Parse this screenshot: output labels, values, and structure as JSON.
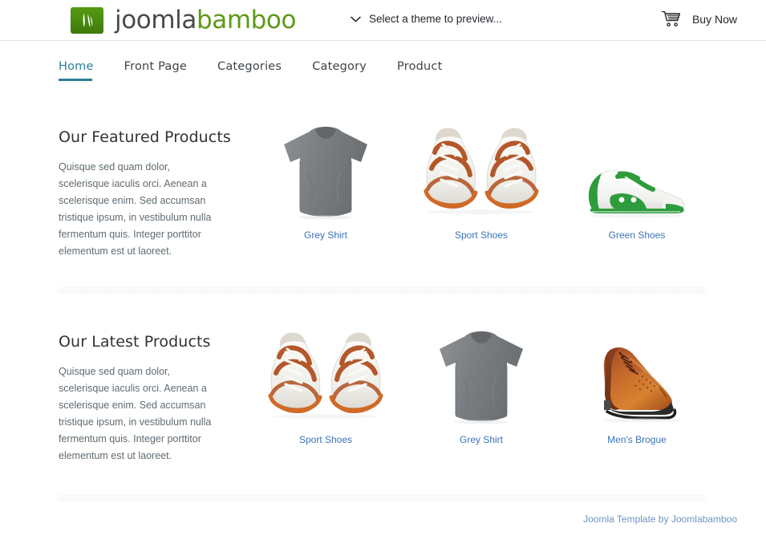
{
  "header": {
    "logo": {
      "icon": "bamboo-leaf-icon",
      "text_primary": "joomla",
      "text_secondary": "bamboo",
      "brand_green": "#5e9a18",
      "mark_bg": "#4b8a10"
    },
    "theme_selector": {
      "icon": "chevron-down-icon",
      "label": "Select a theme to preview..."
    },
    "buy": {
      "icon": "shopping-cart-icon",
      "label": "Buy Now"
    }
  },
  "nav": {
    "active_color": "#2b7d95",
    "items": [
      {
        "label": "Home",
        "active": true
      },
      {
        "label": "Front Page",
        "active": false
      },
      {
        "label": "Categories",
        "active": false
      },
      {
        "label": "Category",
        "active": false
      },
      {
        "label": "Product",
        "active": false
      }
    ]
  },
  "sections": [
    {
      "title": "Our Featured Products",
      "body": "Quisque sed quam dolor, scelerisque iaculis orci. Aenean a scelerisque enim. Sed accumsan tristique ipsum, in vestibulum nulla fermentum quis. Integer porttitor elementum est ut laoreet.",
      "products": [
        {
          "label": "Grey Shirt",
          "image": "grey-tshirt-image"
        },
        {
          "label": "Sport Shoes",
          "image": "white-orange-sneakers-front-image"
        },
        {
          "label": "Green Shoes",
          "image": "green-white-sneaker-side-image"
        }
      ]
    },
    {
      "title": "Our Latest Products",
      "body": "Quisque sed quam dolor, scelerisque iaculis orci. Aenean a scelerisque enim. Sed accumsan tristique ipsum, in vestibulum nulla fermentum quis. Integer porttitor elementum est ut laoreet.",
      "products": [
        {
          "label": "Sport Shoes",
          "image": "white-orange-sneakers-front-image"
        },
        {
          "label": "Grey Shirt",
          "image": "grey-tshirt-image"
        },
        {
          "label": "Men's Brogue",
          "image": "brown-leather-brogue-image"
        }
      ]
    }
  ],
  "footer": {
    "text": "Joomla Template by Joomlabamboo",
    "link_color": "#6e93c4"
  }
}
